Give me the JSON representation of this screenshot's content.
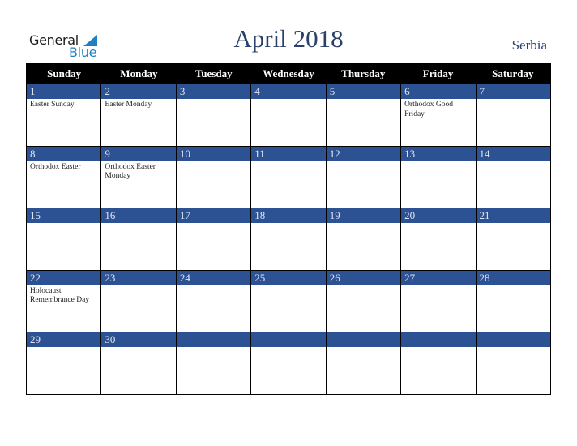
{
  "logo": {
    "word1": "General",
    "word2": "Blue",
    "icon": "triangle-flag-icon",
    "brand_color": "#1f7fc4"
  },
  "header": {
    "title": "April 2018",
    "country": "Serbia"
  },
  "colors": {
    "title": "#2a416b",
    "band": "#2d5293",
    "header_bg": "#000000"
  },
  "weekdays": [
    "Sunday",
    "Monday",
    "Tuesday",
    "Wednesday",
    "Thursday",
    "Friday",
    "Saturday"
  ],
  "weeks": [
    {
      "days": [
        {
          "num": "1",
          "event": "Easter Sunday"
        },
        {
          "num": "2",
          "event": "Easter Monday"
        },
        {
          "num": "3",
          "event": ""
        },
        {
          "num": "4",
          "event": ""
        },
        {
          "num": "5",
          "event": ""
        },
        {
          "num": "6",
          "event": "Orthodox Good Friday"
        },
        {
          "num": "7",
          "event": ""
        }
      ]
    },
    {
      "days": [
        {
          "num": "8",
          "event": "Orthodox Easter"
        },
        {
          "num": "9",
          "event": "Orthodox Easter Monday"
        },
        {
          "num": "10",
          "event": ""
        },
        {
          "num": "11",
          "event": ""
        },
        {
          "num": "12",
          "event": ""
        },
        {
          "num": "13",
          "event": ""
        },
        {
          "num": "14",
          "event": ""
        }
      ]
    },
    {
      "days": [
        {
          "num": "15",
          "event": ""
        },
        {
          "num": "16",
          "event": ""
        },
        {
          "num": "17",
          "event": ""
        },
        {
          "num": "18",
          "event": ""
        },
        {
          "num": "19",
          "event": ""
        },
        {
          "num": "20",
          "event": ""
        },
        {
          "num": "21",
          "event": ""
        }
      ]
    },
    {
      "days": [
        {
          "num": "22",
          "event": "Holocaust Remembrance Day"
        },
        {
          "num": "23",
          "event": ""
        },
        {
          "num": "24",
          "event": ""
        },
        {
          "num": "25",
          "event": ""
        },
        {
          "num": "26",
          "event": ""
        },
        {
          "num": "27",
          "event": ""
        },
        {
          "num": "28",
          "event": ""
        }
      ]
    },
    {
      "days": [
        {
          "num": "29",
          "event": ""
        },
        {
          "num": "30",
          "event": ""
        },
        {
          "num": "",
          "event": ""
        },
        {
          "num": "",
          "event": ""
        },
        {
          "num": "",
          "event": ""
        },
        {
          "num": "",
          "event": ""
        },
        {
          "num": "",
          "event": ""
        }
      ]
    }
  ]
}
